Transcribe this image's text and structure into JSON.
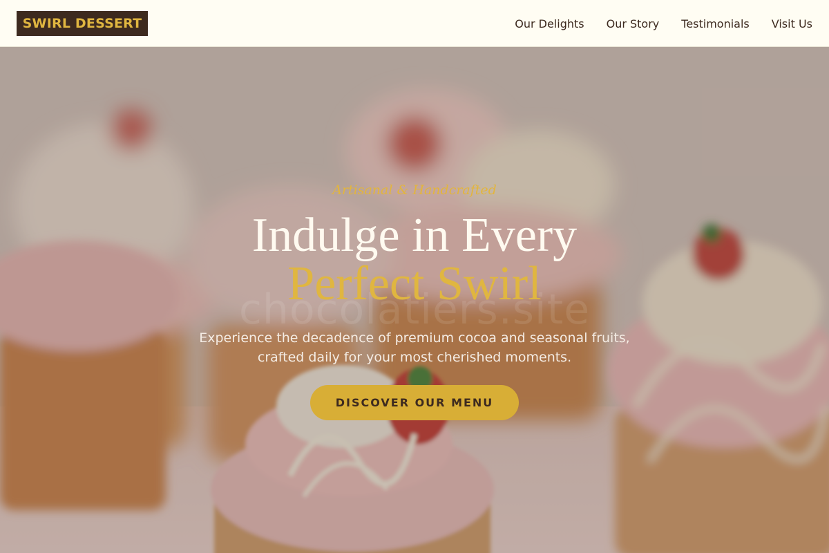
{
  "brand": {
    "logo_text": "SWIRL DESSERT"
  },
  "nav": {
    "items": [
      {
        "label": "Our Delights"
      },
      {
        "label": "Our Story"
      },
      {
        "label": "Testimonials"
      },
      {
        "label": "Visit Us"
      }
    ]
  },
  "hero": {
    "eyebrow": "Artisanal & Handcrafted",
    "headline_line1": "Indulge in Every",
    "headline_line2": "Perfect Swirl",
    "watermark": "chocolatiers.site",
    "subtext_line1": "Experience the decadence of premium cocoa and seasonal fruits,",
    "subtext_line2": "crafted daily for your most cherished moments.",
    "cta_label": "DISCOVER OUR MENU"
  },
  "colors": {
    "header_bg": "#fffdf3",
    "logo_bg": "#3d2a1f",
    "accent_gold": "#e0b640",
    "button_gold": "#d8ae36",
    "text_dark": "#3d2a1f"
  }
}
